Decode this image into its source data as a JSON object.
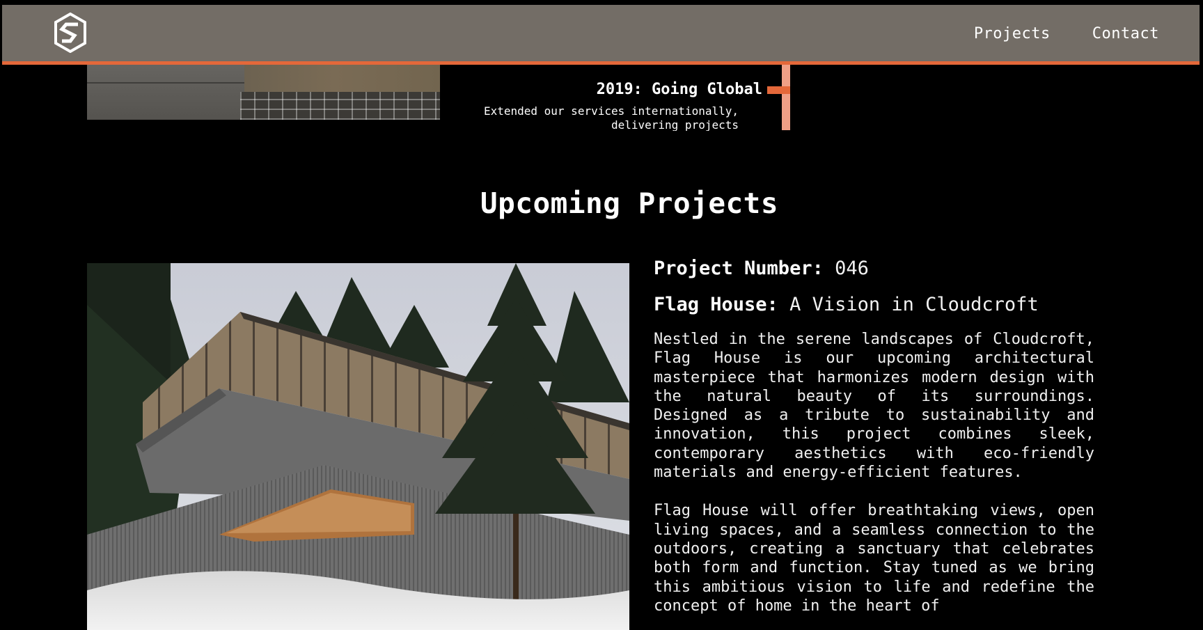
{
  "header": {
    "logo_name": "studio-s-logo",
    "nav": [
      {
        "label": "Projects"
      },
      {
        "label": "Contact"
      }
    ]
  },
  "timeline": {
    "title": "2019: Going Global",
    "description": "Extended our services internationally, delivering projects"
  },
  "section": {
    "title": "Upcoming Projects"
  },
  "project": {
    "number_label": "Project Number:",
    "number_value": "046",
    "name_label": "Flag House:",
    "name_value": "A Vision in Cloudcroft",
    "paragraphs": [
      "Nestled in the serene landscapes of Cloudcroft, Flag House is our upcoming architectural masterpiece that harmonizes modern design with the natural beauty of its surroundings. Designed as a tribute to sustainability and innovation, this project combines sleek, contemporary aesthetics with eco-friendly materials and energy-efficient features.",
      "Flag House will offer breathtaking views, open living spaces, and a seamless connection to the outdoors, creating a sanctuary that celebrates both form and function. Stay tuned as we bring this ambitious vision to life and redefine the concept of home in the heart of"
    ]
  },
  "colors": {
    "header_bg": "#736d66",
    "accent": "#e4683a",
    "accent_light": "#ef9f86",
    "page_bg": "#000000"
  }
}
